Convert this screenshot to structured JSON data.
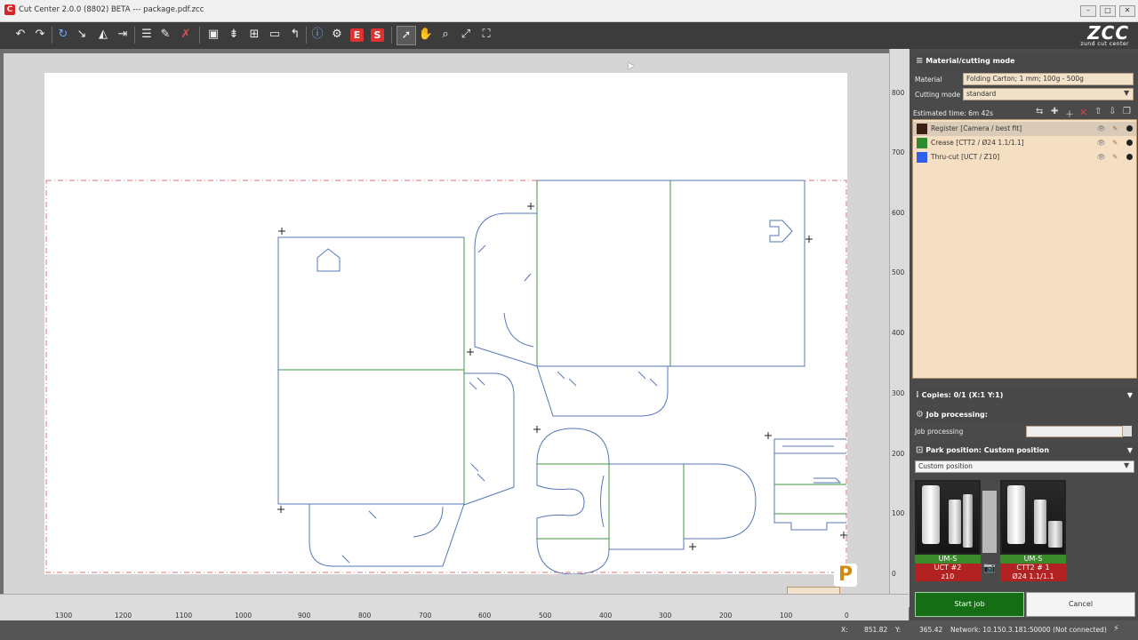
{
  "window": {
    "title": "Cut Center 2.0.0 (8802) BETA  ---  package.pdf.zcc",
    "min_label": "–",
    "max_label": "□",
    "close_label": "✕"
  },
  "toolbar": {
    "icons": [
      "undo-icon",
      "redo-icon",
      "refresh-icon",
      "arrow-icon",
      "mirror-icon",
      "flip-icon",
      "align-icon",
      "edit-icon",
      "delete-icon",
      "frame-icon",
      "layers-icon",
      "split-icon",
      "select-box-icon",
      "path-icon",
      "info-icon",
      "settings-icon",
      "export-e-icon",
      "export-s-icon",
      "pointer-icon",
      "hand-icon",
      "zoom-icon",
      "fit-icon",
      "full-icon"
    ],
    "e_label": "E",
    "s_label": "S",
    "brand": {
      "name": "ZCC",
      "subtitle": "zund cut center"
    }
  },
  "rulers": {
    "horizontal": [
      "1300",
      "1200",
      "1100",
      "1000",
      "900",
      "800",
      "700",
      "600",
      "500",
      "400",
      "300",
      "200",
      "100",
      "0"
    ],
    "vertical": [
      "800",
      "700",
      "600",
      "500",
      "400",
      "300",
      "200",
      "100",
      "0"
    ]
  },
  "canvas": {
    "badge": "P"
  },
  "status": {
    "x_label": "X:",
    "x_value": "851.82",
    "y_label": "Y:",
    "y_value": "365.42",
    "network": "Network: 10.150.3.181:50000 (Not connected)"
  },
  "panel": {
    "material_section": "Material/cutting mode",
    "material_label": "Material",
    "material_value": "Folding Carton; 1 mm; 100g - 500g",
    "cutting_mode_label": "Cutting mode",
    "cutting_mode_value": "standard",
    "estimated_time": "Estimated time: 6m 42s",
    "layers": [
      {
        "name": "Register [Camera / best fit]",
        "color": "#3a1f14"
      },
      {
        "name": "Crease [CTT2 / Ø24 1.1/1.1]",
        "color": "#2e8b2e"
      },
      {
        "name": "Thru-cut [UCT / Z10]",
        "color": "#2f5fe8"
      }
    ],
    "copies": "Copies: 0/1 (X:1 Y:1)",
    "job_processing_section": "Job processing:",
    "job_processing_label": "Job processing",
    "park_section": "Park position: Custom position",
    "park_value": "Custom position",
    "tools": [
      {
        "name": "UM-S",
        "line1": "UCT #2",
        "line2": "z10"
      },
      {
        "name": "UM-S",
        "line1": "CTT2 # 1",
        "line2": "Ø24 1.1/1.1"
      }
    ],
    "start_button": "Start job",
    "cancel_button": "Cancel"
  }
}
